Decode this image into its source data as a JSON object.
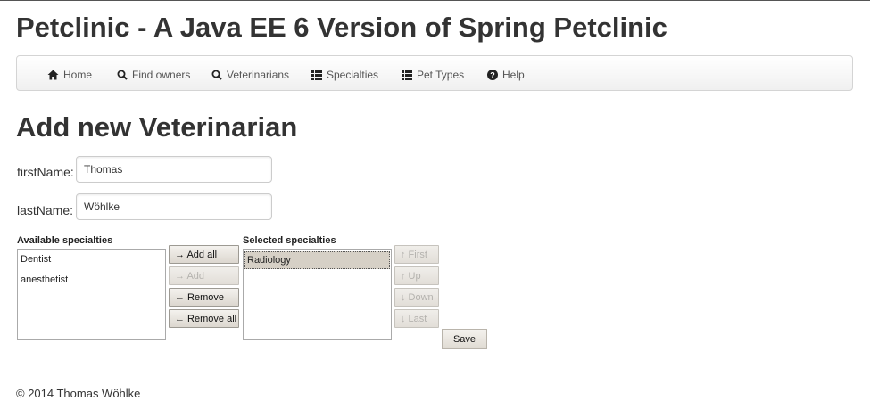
{
  "header": {
    "title": "Petclinic - A Java EE 6 Version of Spring Petclinic"
  },
  "nav": {
    "items": [
      {
        "label": "Home",
        "icon": "home-icon"
      },
      {
        "label": "Find owners",
        "icon": "search-icon"
      },
      {
        "label": "Veterinarians",
        "icon": "search-icon"
      },
      {
        "label": "Specialties",
        "icon": "list-icon"
      },
      {
        "label": "Pet Types",
        "icon": "list-icon"
      },
      {
        "label": "Help",
        "icon": "question-icon"
      }
    ]
  },
  "form": {
    "heading": "Add new Veterinarian",
    "first_name": {
      "label": "firstName:",
      "value": "Thomas"
    },
    "last_name": {
      "label": "lastName:",
      "value": "Wöhlke"
    },
    "available": {
      "caption": "Available specialties",
      "items": [
        "Dentist",
        "anesthetist"
      ]
    },
    "selected": {
      "caption": "Selected specialties",
      "items": [
        "Radiology"
      ]
    },
    "transfer_buttons": {
      "add_all": "→ Add all",
      "add": "→ Add",
      "remove": "← Remove",
      "remove_all": "← Remove all"
    },
    "order_buttons": {
      "first": "↑ First",
      "up": "↑ Up",
      "down": "↓ Down",
      "last": "↓ Last"
    },
    "save_label": "Save"
  },
  "footer": {
    "text": "© 2014 Thomas Wöhlke"
  },
  "colors": {
    "text": "#333333",
    "selected_row": "#d6d0c6",
    "navbar_border": "#d4d4d4"
  }
}
